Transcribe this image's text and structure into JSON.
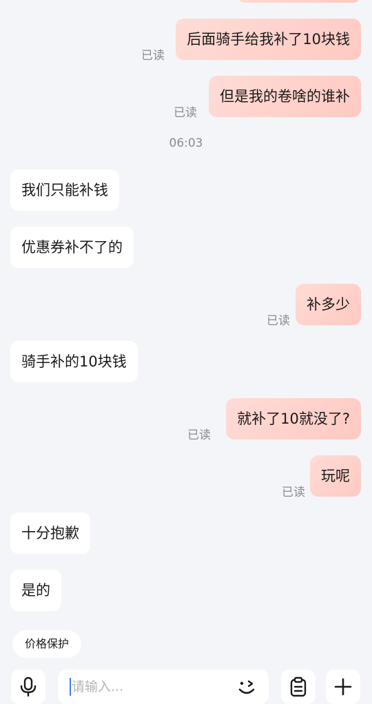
{
  "messages": [
    {
      "id": "m1",
      "side": "out",
      "text": "后面骑手给我补了10块钱",
      "status": "已读"
    },
    {
      "id": "m2",
      "side": "out",
      "text": "但是我的卷啥的谁补",
      "status": "已读"
    },
    {
      "id": "m3",
      "side": "in",
      "text": "我们只能补钱"
    },
    {
      "id": "m4",
      "side": "in",
      "text": "优惠券补不了的"
    },
    {
      "id": "m5",
      "side": "out",
      "text": "补多少",
      "status": "已读"
    },
    {
      "id": "m6",
      "side": "in",
      "text": "骑手补的10块钱"
    },
    {
      "id": "m7",
      "side": "out",
      "text": "就补了10就没了?",
      "status": "已读"
    },
    {
      "id": "m8",
      "side": "out",
      "text": "玩呢",
      "status": "已读"
    },
    {
      "id": "m9",
      "side": "in",
      "text": "十分抱歉"
    },
    {
      "id": "m10",
      "side": "in",
      "text": "是的"
    }
  ],
  "timestamp": "06:03",
  "quick_reply": {
    "label": "价格保护"
  },
  "input": {
    "placeholder": "请输入..."
  },
  "icons": {
    "voice": "microphone-icon",
    "emoji": "emoji-icon",
    "clipboard": "clipboard-icon",
    "more": "plus-icon"
  },
  "colors": {
    "background": "#f4f5f9",
    "outgoing_bubble": "#ffd1cb",
    "incoming_bubble": "#ffffff",
    "read_status": "#8b8b8f",
    "caret": "#3a7bfd"
  }
}
